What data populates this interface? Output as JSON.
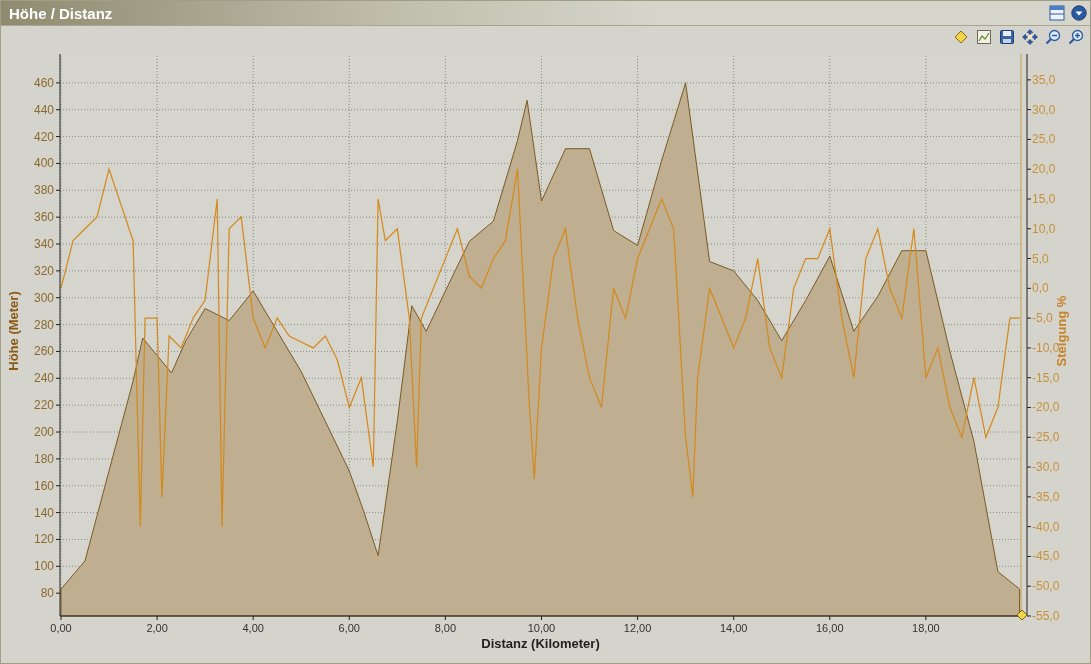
{
  "window": {
    "title": "Höhe / Distanz"
  },
  "toolbar": {
    "buttons": [
      {
        "kind": "marker"
      },
      {
        "kind": "chart"
      },
      {
        "kind": "save"
      },
      {
        "kind": "move"
      },
      {
        "kind": "zoomout"
      },
      {
        "kind": "zoomin"
      }
    ]
  },
  "chart": {
    "chart_data": {
      "type": "area",
      "xlabel": "Distanz (Kilometer)",
      "ylabel": "Höhe (Meter)",
      "xlim": [
        0,
        20
      ],
      "ylim": [
        63,
        480
      ],
      "xticks": [
        {
          "value": 0,
          "label": "0,00"
        },
        {
          "value": 2,
          "label": "2,00"
        },
        {
          "value": 4,
          "label": "4,00"
        },
        {
          "value": 6,
          "label": "6,00"
        },
        {
          "value": 8,
          "label": "8,00"
        },
        {
          "value": 10,
          "label": "10,00"
        },
        {
          "value": 12,
          "label": "12,00"
        },
        {
          "value": 14,
          "label": "14,00"
        },
        {
          "value": 16,
          "label": "16,00"
        },
        {
          "value": 18,
          "label": "18,00"
        }
      ],
      "yticks": [
        80,
        100,
        120,
        140,
        160,
        180,
        200,
        220,
        240,
        260,
        280,
        300,
        320,
        340,
        360,
        380,
        400,
        420,
        440,
        460
      ],
      "x": [
        0,
        0.5,
        1,
        1.5,
        1.7,
        2,
        2.3,
        2.6,
        3,
        3.5,
        4,
        4.5,
        5,
        5.5,
        6,
        6.3,
        6.6,
        7,
        7.3,
        7.6,
        8,
        8.5,
        9,
        9.5,
        9.7,
        10,
        10.5,
        11,
        11.5,
        12,
        12.5,
        13,
        13.5,
        14,
        14.5,
        15,
        15.5,
        16,
        16.5,
        17,
        17.5,
        18,
        18.5,
        19,
        19.5,
        19.95
      ],
      "series": [
        {
          "color": "#bfae90",
          "values": [
            83,
            104,
            171,
            238,
            270,
            257,
            244,
            268,
            292,
            283,
            305,
            275,
            245,
            208,
            171,
            141,
            108,
            208,
            294,
            275,
            305,
            342,
            357,
            417,
            447,
            372,
            411,
            411,
            350,
            339,
            402,
            460,
            327,
            320,
            298,
            268,
            298,
            331,
            275,
            301,
            335,
            335,
            260,
            193,
            96,
            83
          ]
        }
      ]
    }
  },
  "gradient": {
    "chart_data": {
      "type": "line",
      "ylabel": "Steigung %",
      "xlim": [
        0,
        20
      ],
      "ylim": [
        -55,
        39
      ],
      "yticks": [
        {
          "value": 35,
          "label": "35,0"
        },
        {
          "value": 30,
          "label": "30,0"
        },
        {
          "value": 25,
          "label": "25,0"
        },
        {
          "value": 20,
          "label": "20,0"
        },
        {
          "value": 15,
          "label": "15,0"
        },
        {
          "value": 10,
          "label": "10,0"
        },
        {
          "value": 5,
          "label": "5,0"
        },
        {
          "value": 0,
          "label": "0,0"
        },
        {
          "value": -5,
          "label": "-5,0"
        },
        {
          "value": -10,
          "label": "-10,0"
        },
        {
          "value": -15,
          "label": "-15,0"
        },
        {
          "value": -20,
          "label": "-20,0"
        },
        {
          "value": -25,
          "label": "-25,0"
        },
        {
          "value": -30,
          "label": "-30,0"
        },
        {
          "value": -35,
          "label": "-35,0"
        },
        {
          "value": -40,
          "label": "-40,0"
        },
        {
          "value": -45,
          "label": "-45,0"
        },
        {
          "value": -50,
          "label": "-50,0"
        },
        {
          "value": -55,
          "label": "-55,0"
        }
      ],
      "x": [
        0,
        0.25,
        0.5,
        0.75,
        1,
        1.25,
        1.5,
        1.65,
        1.75,
        2,
        2.1,
        2.25,
        2.5,
        2.75,
        3,
        3.25,
        3.35,
        3.5,
        3.75,
        4,
        4.25,
        4.5,
        4.75,
        5,
        5.25,
        5.5,
        5.75,
        6,
        6.25,
        6.5,
        6.6,
        6.75,
        7,
        7.25,
        7.4,
        7.5,
        7.75,
        8,
        8.25,
        8.5,
        8.75,
        9,
        9.25,
        9.5,
        9.75,
        9.85,
        10,
        10.25,
        10.5,
        10.75,
        11,
        11.25,
        11.5,
        11.75,
        12,
        12.25,
        12.5,
        12.75,
        13,
        13.15,
        13.25,
        13.5,
        13.75,
        14,
        14.25,
        14.5,
        14.75,
        15,
        15.25,
        15.5,
        15.75,
        16,
        16.25,
        16.5,
        16.75,
        17,
        17.25,
        17.5,
        17.75,
        18,
        18.25,
        18.5,
        18.75,
        19,
        19.25,
        19.5,
        19.75,
        19.95
      ],
      "series": [
        {
          "color": "#d4891a",
          "values": [
            0,
            8,
            10,
            12,
            20,
            14,
            8,
            -40,
            -5,
            -5,
            -35,
            -8,
            -10,
            -5,
            -2,
            15,
            -40,
            10,
            12,
            -5,
            -10,
            -5,
            -8,
            -9,
            -10,
            -8,
            -12,
            -20,
            -15,
            -30,
            15,
            8,
            10,
            -5,
            -30,
            -5,
            0,
            5,
            10,
            2,
            0,
            5,
            8,
            20,
            -20,
            -32,
            -10,
            5,
            10,
            -5,
            -15,
            -20,
            0,
            -5,
            5,
            10,
            15,
            10,
            -25,
            -35,
            -15,
            0,
            -5,
            -10,
            -5,
            5,
            -10,
            -15,
            0,
            5,
            5,
            10,
            -5,
            -15,
            5,
            10,
            0,
            -5,
            10,
            -15,
            -10,
            -20,
            -25,
            -15,
            -25,
            -20,
            -5,
            -5
          ]
        }
      ]
    }
  }
}
